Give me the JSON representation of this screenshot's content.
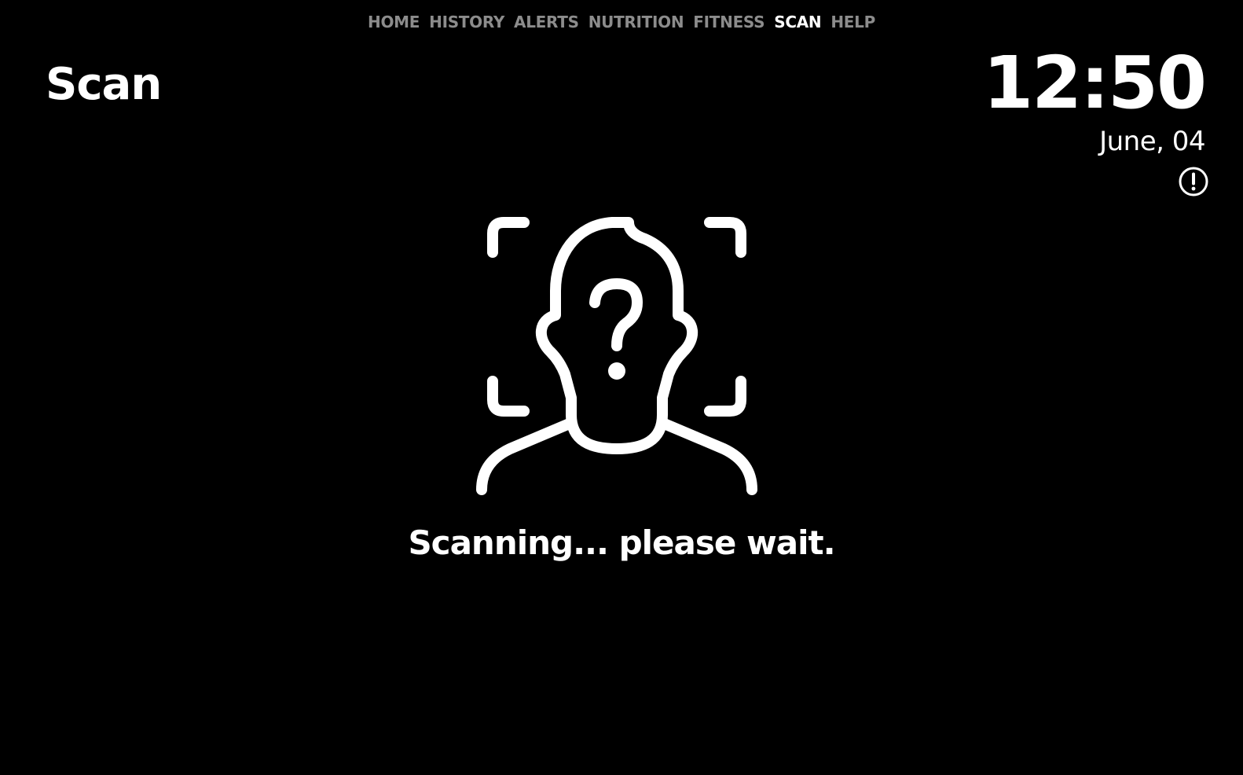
{
  "nav": {
    "items": [
      {
        "label": "HOME",
        "active": false
      },
      {
        "label": "HISTORY",
        "active": false
      },
      {
        "label": "ALERTS",
        "active": false
      },
      {
        "label": "NUTRITION",
        "active": false
      },
      {
        "label": "FITNESS",
        "active": false
      },
      {
        "label": "SCAN",
        "active": true
      },
      {
        "label": "HELP",
        "active": false
      }
    ]
  },
  "page": {
    "title": "Scan"
  },
  "clock": {
    "time": "12:50",
    "date": "June, 04"
  },
  "icons": {
    "alert": "alert-circle-icon",
    "scan": "face-scan-unknown-icon"
  },
  "scan": {
    "status": "Scanning... please wait."
  },
  "colors": {
    "background": "#000000",
    "text": "#ffffff",
    "nav_inactive": "#8c8c8c",
    "nav_active": "#ffffff"
  }
}
